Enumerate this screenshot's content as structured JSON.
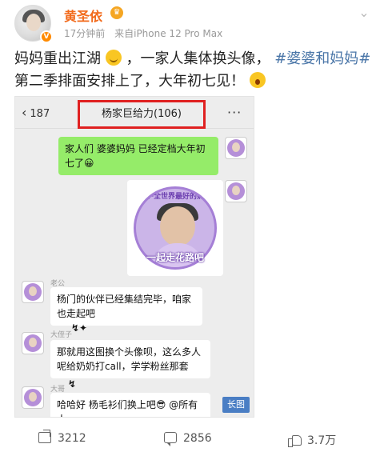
{
  "post": {
    "username": "黄圣依",
    "time": "17分钟前",
    "source": "来自iPhone 12 Pro Max",
    "text_1": "妈妈重出江湖",
    "text_2": "，一家人集体换头像，",
    "tag_1": "#婆婆和妈妈#",
    "text_3": " 第二季排面安排上了，大年初七见！"
  },
  "chat": {
    "back_count": "187",
    "title": "杨家巨给力(106)",
    "msg_1": "家人们 婆婆妈妈 已经定档大年初七了😀",
    "image_slogan": "一起走花路吧",
    "image_arc": "守护全世界最好的奶奶",
    "sender_1": "老公",
    "msg_2": "杨门的伙伴已经集结完毕，咱家也走起吧",
    "sender_2": "大侄子",
    "msg_3": "那就用这图换个头像呗，这么多人呢给奶奶打call，学学粉丝那套",
    "sender_3": "大哥",
    "msg_4": "哈哈好 杨毛衫们换上吧😎 @所有人",
    "long_image_label": "长图"
  },
  "footer": {
    "shares": "3212",
    "comments": "2856",
    "likes": "3.7万"
  },
  "icons": {
    "more": "chevron-down-icon",
    "share": "share-icon",
    "comment": "comment-icon",
    "like": "like-icon"
  },
  "colors": {
    "username": "#f26a1b",
    "tag": "#4a76a8",
    "bubble_green": "#95ec69",
    "highlight_box": "#e02020"
  }
}
